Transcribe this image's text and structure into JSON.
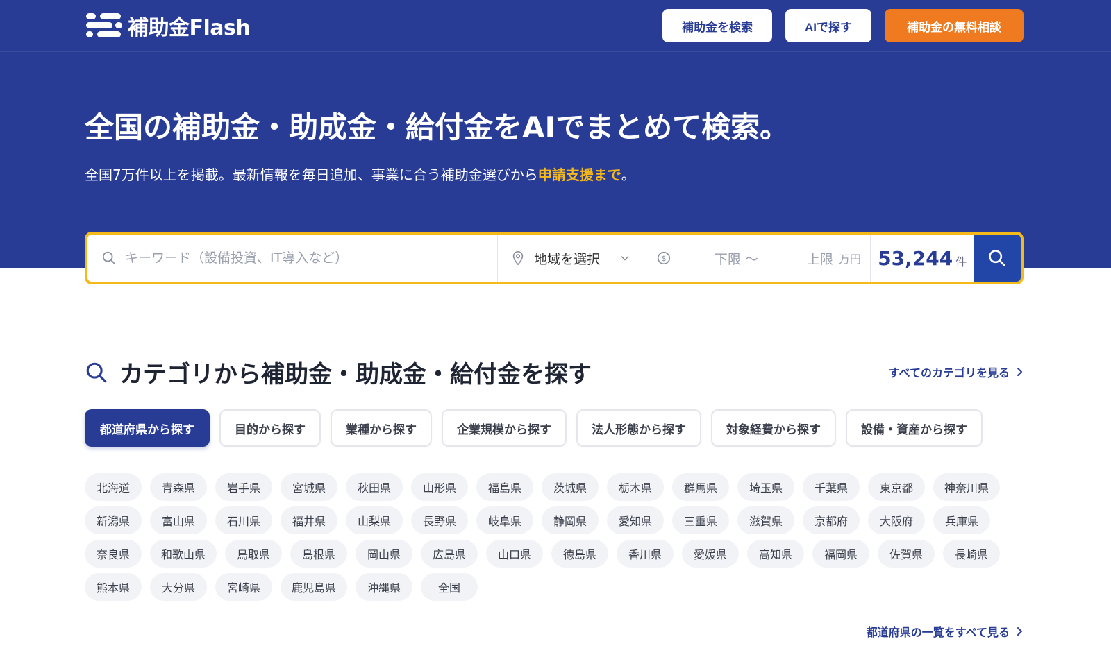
{
  "header": {
    "logo_text": "補助金Flash",
    "nav": {
      "search_label": "補助金を検索",
      "ai_label": "AIで探す",
      "consult_label": "補助金の無料相談"
    }
  },
  "hero": {
    "title": "全国の補助金・助成金・給付金をAIでまとめて検索。",
    "subtitle_main": "全国7万件以上を掲載。最新情報を毎日追加、事業に合う補助金選びから",
    "subtitle_highlight": "申請支援まで",
    "subtitle_end": "。"
  },
  "search": {
    "keyword_placeholder": "キーワード（設備投資、IT導入など）",
    "region_label": "地域を選択",
    "amount_min": "下限 〜",
    "amount_max": "上限",
    "amount_unit": "万円",
    "result_count": "53,244",
    "result_unit": "件"
  },
  "categories": {
    "title": "カテゴリから補助金・助成金・給付金を探す",
    "see_all": "すべてのカテゴリを見る",
    "tabs": [
      "都道府県から探す",
      "目的から探す",
      "業種から探す",
      "企業規模から探す",
      "法人形態から探す",
      "対象経費から探す",
      "設備・資産から探す"
    ],
    "active_tab": 0,
    "prefectures": [
      "北海道",
      "青森県",
      "岩手県",
      "宮城県",
      "秋田県",
      "山形県",
      "福島県",
      "茨城県",
      "栃木県",
      "群馬県",
      "埼玉県",
      "千葉県",
      "東京都",
      "神奈川県",
      "新潟県",
      "富山県",
      "石川県",
      "福井県",
      "山梨県",
      "長野県",
      "岐阜県",
      "静岡県",
      "愛知県",
      "三重県",
      "滋賀県",
      "京都府",
      "大阪府",
      "兵庫県",
      "奈良県",
      "和歌山県",
      "鳥取県",
      "島根県",
      "岡山県",
      "広島県",
      "山口県",
      "徳島県",
      "香川県",
      "愛媛県",
      "高知県",
      "福岡県",
      "佐賀県",
      "長崎県",
      "熊本県",
      "大分県",
      "宮崎県",
      "鹿児島県",
      "沖縄県",
      "全国"
    ],
    "prefectures_see_all": "都道府県の一覧をすべて見る"
  },
  "colors": {
    "brand": "#283c96",
    "accent": "#f07a1f",
    "highlight": "#f6b91a"
  }
}
